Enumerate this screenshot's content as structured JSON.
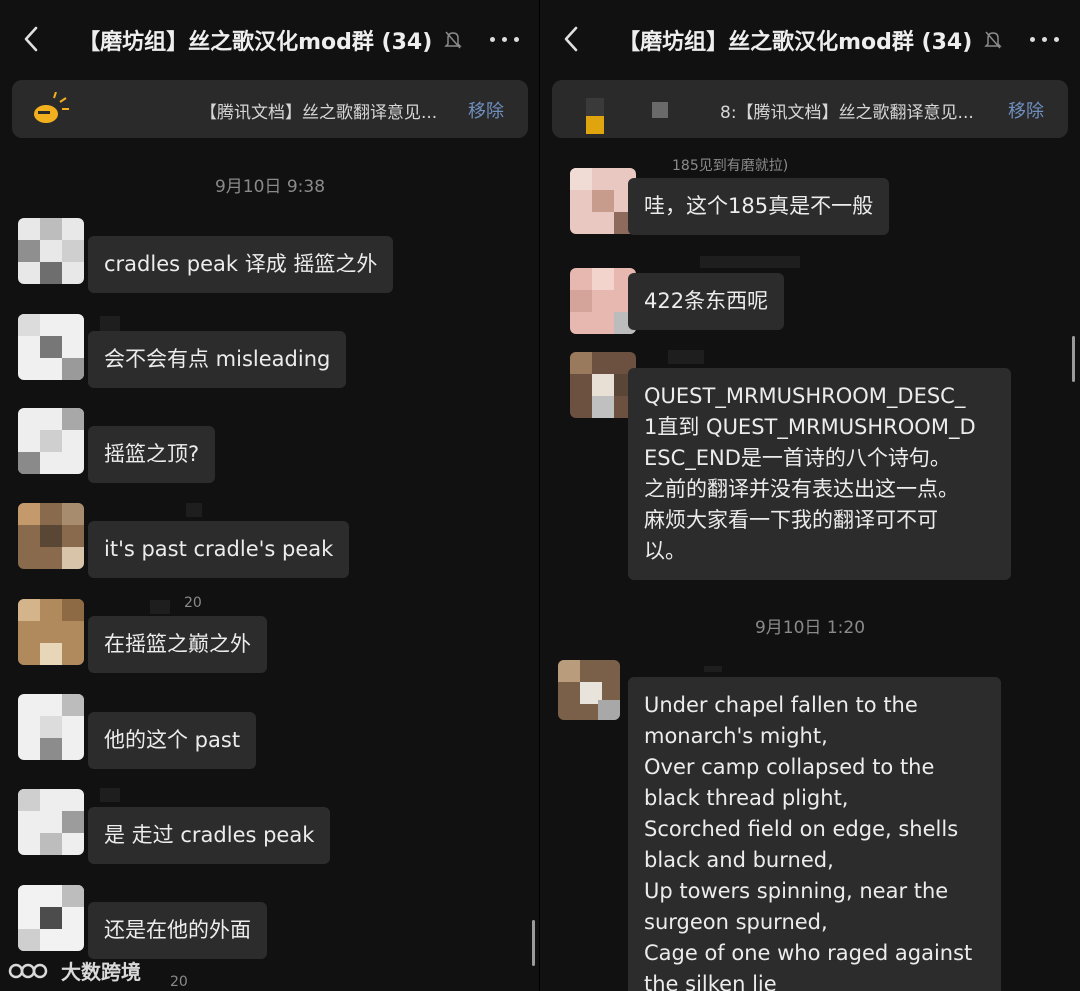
{
  "left": {
    "title": "【磨坊组】丝之歌汉化mod群 (34)",
    "pinned": {
      "text": "【腾讯文档】丝之歌翻译意见...",
      "remove": "移除"
    },
    "timestamp": "9月10日 9:38",
    "messages": [
      {
        "text": "cradles peak 译成 摇篮之外"
      },
      {
        "text": "会不会有点 misleading"
      },
      {
        "text": "摇篮之顶?"
      },
      {
        "text": "it's past cradle's peak"
      },
      {
        "text": "在摇篮之巅之外"
      },
      {
        "text": "他的这个 past"
      },
      {
        "text": "是 走过 cradles peak"
      },
      {
        "text": "还是在他的外面"
      }
    ],
    "faint": {
      "n20a": "20",
      "n20b": "20"
    }
  },
  "right": {
    "title": "【磨坊组】丝之歌汉化mod群 (34)",
    "pinned": {
      "text": "8:【腾讯文档】丝之歌翻译意见...",
      "remove": "移除"
    },
    "quote_fragment": "185见到有磨就拉)",
    "messages": [
      {
        "text": "哇，这个185真是不一般"
      },
      {
        "text": "422条东西呢"
      }
    ],
    "long_message": [
      "QUEST_MRMUSHROOM_DESC_",
      "1直到 QUEST_MRMUSHROOM_D",
      "ESC_END是一首诗的八个诗句。",
      "之前的翻译并没有表达出这一点。",
      "麻烦大家看一下我的翻译可不可",
      "以。"
    ],
    "timestamp": "9月10日 1:20",
    "poem": [
      "Under chapel fallen to the",
      "monarch's might,",
      "Over camp collapsed to the",
      "black thread plight,",
      "Scorched field on edge, shells",
      "black and burned,",
      "Up towers spinning, near the",
      "surgeon spurned,",
      "Cage of one who raged against",
      "the silken lie"
    ]
  },
  "watermark": "大数跨境",
  "colors": {
    "background": "#111111",
    "bubble": "#2c2c2c",
    "accent": "#6f8fbf",
    "timestamp": "#8a8a8a"
  },
  "icons": [
    "back-arrow-icon",
    "mute-bell-icon",
    "more-dots-icon",
    "announcement-icon",
    "document-icon"
  ]
}
